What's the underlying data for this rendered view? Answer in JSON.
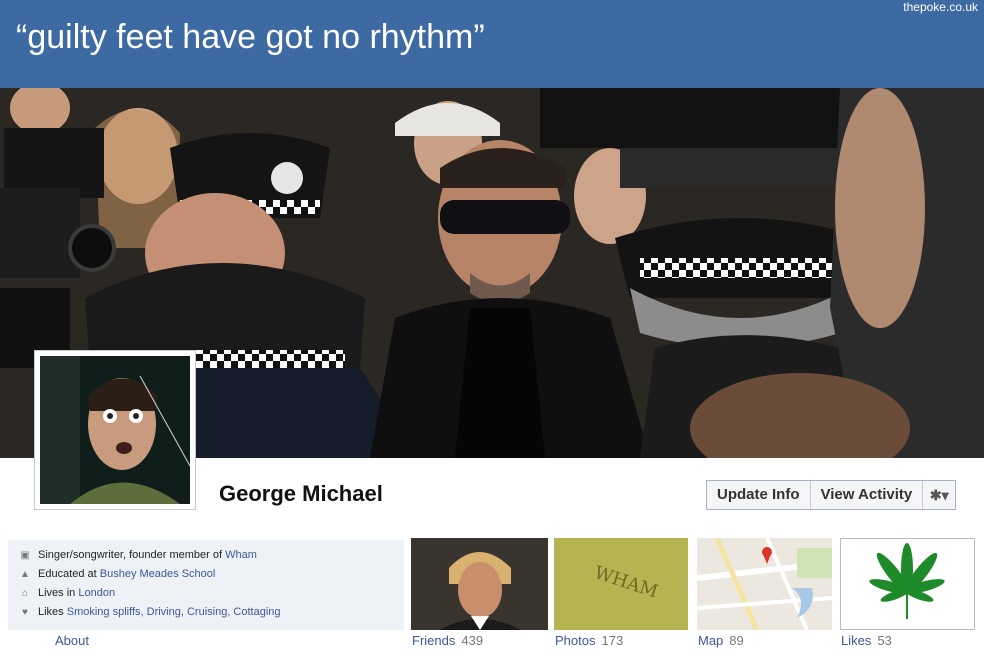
{
  "watermark": "thepoke.co.uk",
  "quote": "“guilty feet have got no rhythm”",
  "profile": {
    "name": "George Michael"
  },
  "actions": {
    "update_info": "Update Info",
    "view_activity": "View Activity"
  },
  "about": {
    "work_prefix": "Singer/songwriter, founder member of",
    "work_link": "Wham",
    "edu_prefix": "Educated at",
    "edu_link": "Bushey Meades School",
    "lives_prefix": "Lives in",
    "lives_link": "London",
    "likes_prefix": "Likes",
    "likes_link": "Smoking spliffs, Driving, Cruising, Cottaging",
    "tab_label": "About"
  },
  "tiles": {
    "friends_label": "Friends",
    "friends_count": "439",
    "photos_label": "Photos",
    "photos_count": "173",
    "map_label": "Map",
    "map_count": "89",
    "likes_label": "Likes",
    "likes_count": "53"
  },
  "photos_thumb_text": "WHAM",
  "icons": {
    "briefcase": "briefcase-icon",
    "graduation": "graduation-cap-icon",
    "house": "house-icon",
    "heart": "heart-icon",
    "gear": "gear-icon"
  },
  "colors": {
    "banner": "#3e6aa3",
    "link": "#3b5998",
    "about_bg": "#eef1f6"
  }
}
